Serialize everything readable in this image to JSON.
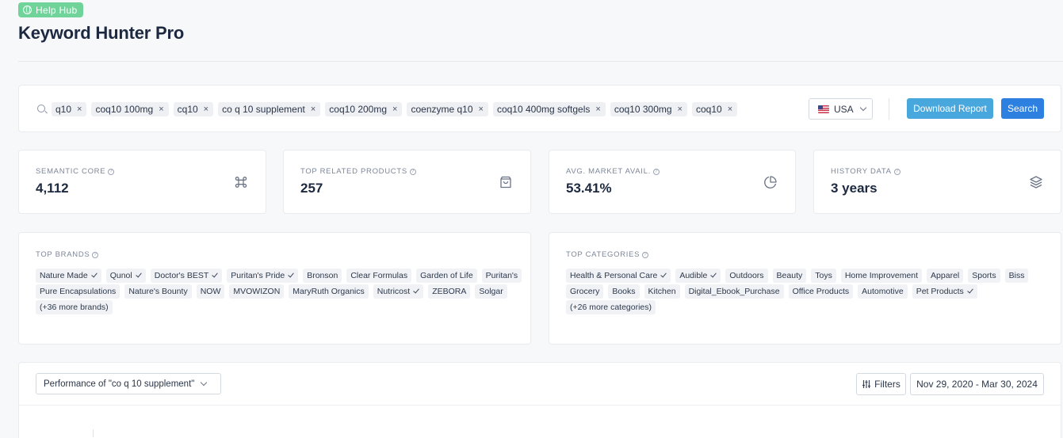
{
  "help_hub": {
    "label": "Help Hub"
  },
  "page": {
    "title": "Keyword Hunter Pro"
  },
  "search": {
    "keywords": [
      "q10",
      "coq10 100mg",
      "cq10",
      "co q 10 supplement",
      "coq10 200mg",
      "coenzyme q10",
      "coq10 400mg softgels",
      "coq10 300mg",
      "coq10"
    ],
    "remove_glyph": "×",
    "country": "USA",
    "download_label": "Download Report",
    "search_label": "Search"
  },
  "stats": [
    {
      "label": "SEMANTIC CORE",
      "value": "4,112",
      "icon": "command-icon"
    },
    {
      "label": "TOP RELATED PRODUCTS",
      "value": "257",
      "icon": "shopping-bag-icon"
    },
    {
      "label": "AVG. MARKET AVAIL.",
      "value": "53.41%",
      "icon": "pie-chart-icon"
    },
    {
      "label": "HISTORY DATA",
      "value": "3 years",
      "icon": "layers-icon"
    }
  ],
  "brands": {
    "label": "TOP BRANDS",
    "items": [
      {
        "name": "Nature Made",
        "verified": true
      },
      {
        "name": "Qunol",
        "verified": true
      },
      {
        "name": "Doctor's BEST",
        "verified": true
      },
      {
        "name": "Puritan's Pride",
        "verified": true
      },
      {
        "name": "Bronson",
        "verified": false
      },
      {
        "name": "Clear Formulas",
        "verified": false
      },
      {
        "name": "Garden of Life",
        "verified": false
      },
      {
        "name": "Puritan's",
        "verified": false
      },
      {
        "name": "Pure Encapsulations",
        "verified": false
      },
      {
        "name": "Nature's Bounty",
        "verified": false
      },
      {
        "name": "NOW",
        "verified": false
      },
      {
        "name": "MVOWIZON",
        "verified": false
      },
      {
        "name": "MaryRuth Organics",
        "verified": false
      },
      {
        "name": "Nutricost",
        "verified": true
      },
      {
        "name": "ZEBORA",
        "verified": false
      },
      {
        "name": "Solgar",
        "verified": false
      }
    ],
    "more": "(+36 more brands)"
  },
  "categories": {
    "label": "TOP CATEGORIES",
    "items": [
      {
        "name": "Health & Personal Care",
        "verified": true
      },
      {
        "name": "Audible",
        "verified": true
      },
      {
        "name": "Outdoors",
        "verified": false
      },
      {
        "name": "Beauty",
        "verified": false
      },
      {
        "name": "Toys",
        "verified": false
      },
      {
        "name": "Home Improvement",
        "verified": false
      },
      {
        "name": "Apparel",
        "verified": false
      },
      {
        "name": "Sports",
        "verified": false
      },
      {
        "name": "Biss",
        "verified": false
      },
      {
        "name": "Grocery",
        "verified": false
      },
      {
        "name": "Books",
        "verified": false
      },
      {
        "name": "Kitchen",
        "verified": false
      },
      {
        "name": "Digital_Ebook_Purchase",
        "verified": false
      },
      {
        "name": "Office Products",
        "verified": false
      },
      {
        "name": "Automotive",
        "verified": false
      },
      {
        "name": "Pet Products",
        "verified": true
      }
    ],
    "more": "(+26 more categories)"
  },
  "performance": {
    "select_label": "Performance of \"co q 10 supplement\"",
    "filters_label": "Filters",
    "date_range": "Nov 29, 2020 - Mar 30, 2024"
  },
  "colors": {
    "help_hub": "#6fd39a",
    "download_button": "#48a8dd",
    "search_button": "#2d7fe0"
  }
}
